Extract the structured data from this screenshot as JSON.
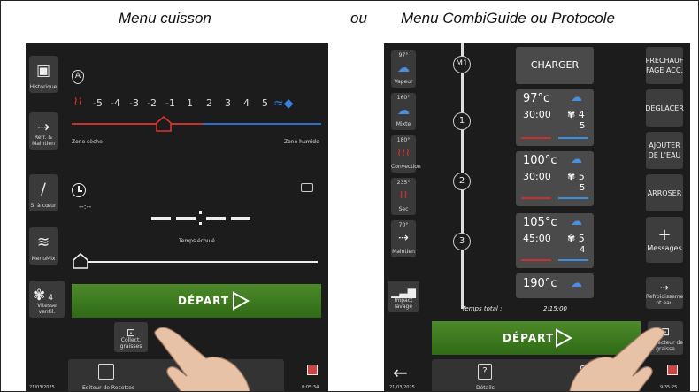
{
  "captions": {
    "left": "Menu cuisson",
    "middle": "ou",
    "right": "Menu CombiGuide ou Protocole"
  },
  "left": {
    "sidebar": [
      {
        "icon": "history-icon",
        "label": "Historique"
      },
      {
        "icon": "hold-icon",
        "label": "Refr. & Maintien"
      },
      {
        "icon": "probe-icon",
        "label": "S. à cœur"
      },
      {
        "icon": "menumix-icon",
        "label": "MenuMix"
      },
      {
        "icon": "fan-icon",
        "label": "Vitesse ventil.",
        "value": "4"
      }
    ],
    "mode_badge": "A",
    "humidity_scale": [
      "-5",
      "-4",
      "-3",
      "-2",
      "-1",
      "1",
      "2",
      "3",
      "4",
      "5"
    ],
    "zone_dry": "Zone sèche",
    "zone_humid": "Zone humide",
    "time_value": "--:--",
    "elapsed_label": "Temps écoulé",
    "start_label": "DÉPART",
    "grease_label": "Collect. graisses",
    "footer": {
      "date": "21/03/2025",
      "recipe_editor": "Editeur de Recettes",
      "clock": "8:05:34"
    }
  },
  "right": {
    "modes": [
      {
        "temp": "97°",
        "label": "Vapeur",
        "icon": "steam-icon"
      },
      {
        "temp": "160°",
        "label": "Mixte",
        "icon": "mixed-icon"
      },
      {
        "temp": "180°",
        "label": "Convection",
        "icon": "convection-icon"
      },
      {
        "temp": "235°",
        "label": "Sec",
        "icon": "dry-icon"
      },
      {
        "temp": "70°",
        "label": "Maintien",
        "icon": "hold-icon"
      }
    ],
    "impact_label": "Impact lavage",
    "steps": [
      "M1",
      "1",
      "2",
      "3"
    ],
    "charger_label": "CHARGER",
    "cards": [
      {
        "temp": "97°c",
        "time": "30:00",
        "fan": "4",
        "hum": "5"
      },
      {
        "temp": "100°c",
        "time": "30:00",
        "fan": "5",
        "hum": "5"
      },
      {
        "temp": "105°c",
        "time": "45:00",
        "fan": "5",
        "hum": "4"
      },
      {
        "temp": "190°c",
        "time": "",
        "fan": "",
        "hum": ""
      }
    ],
    "total_label": "Temps total :",
    "total_value": "2:15:00",
    "actions": [
      "PRECHAUF FAGE ACC.",
      "DEGLACER",
      "AJOUTER DE L'EAU",
      "ARROSER",
      "Messages"
    ],
    "messages_plus": "+",
    "cooling_label": "Refroidisseme nt eau",
    "grease_label": "Collecteur de graisse",
    "start_label": "DÉPART",
    "footer": {
      "date": "21/03/2025",
      "details": "Détails",
      "clock": "9:35:25"
    }
  }
}
